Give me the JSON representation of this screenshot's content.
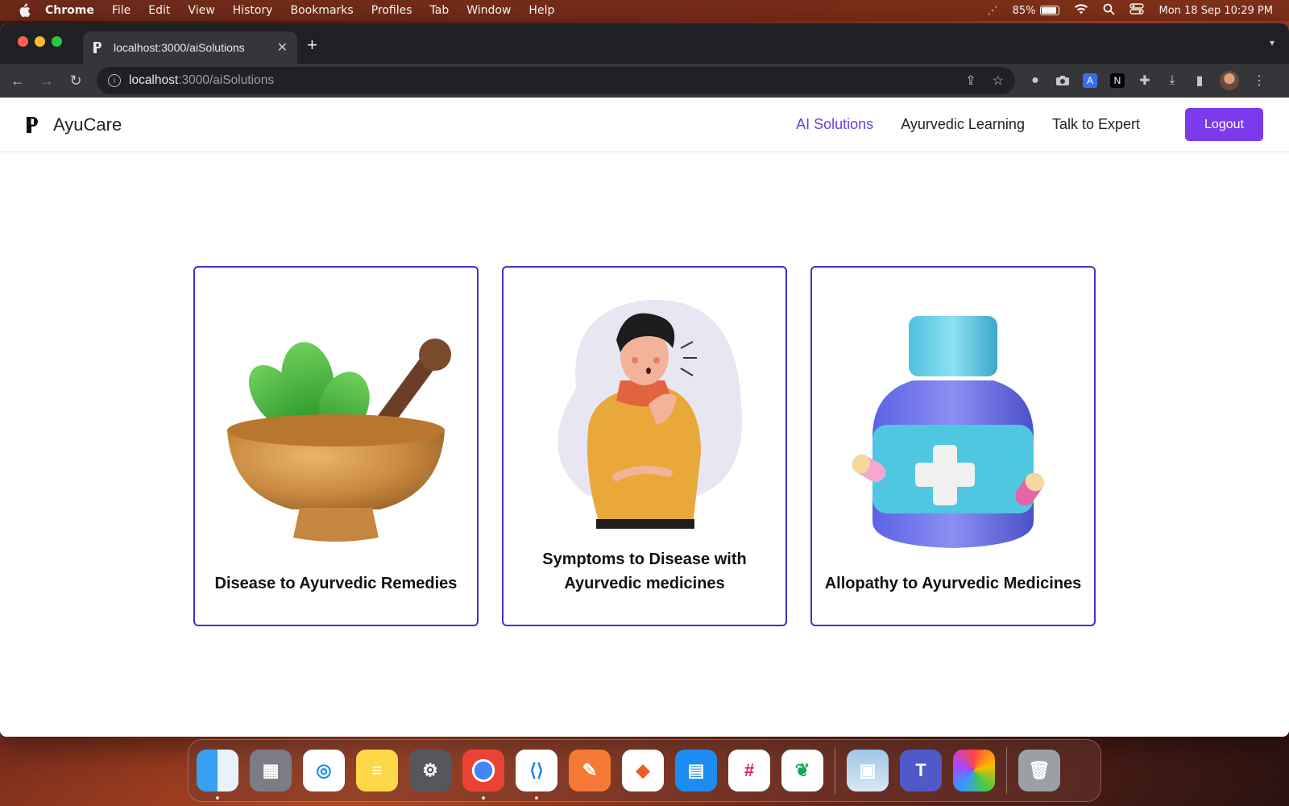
{
  "menubar": {
    "app": "Chrome",
    "items": [
      "File",
      "Edit",
      "View",
      "History",
      "Bookmarks",
      "Profiles",
      "Tab",
      "Window",
      "Help"
    ],
    "battery": "85%",
    "datetime": "Mon 18 Sep  10:29 PM"
  },
  "browser": {
    "tab_title": "localhost:3000/aiSolutions",
    "url_host": "localhost",
    "url_path": ":3000/aiSolutions"
  },
  "app": {
    "brand": "AyuCare",
    "nav": {
      "ai_solutions": "AI Solutions",
      "ayurvedic_learning": "Ayurvedic Learning",
      "talk_to_expert": "Talk to Expert",
      "logout": "Logout"
    },
    "cards": [
      {
        "caption": "Disease to Ayurvedic Remedies",
        "icon": "mortar-pestle-herbs-icon"
      },
      {
        "caption": "Symptoms to Disease with Ayurvedic medicines",
        "icon": "coughing-person-icon"
      },
      {
        "caption": "Allopathy to Ayurvedic Medicines",
        "icon": "medicine-bottle-icon"
      }
    ]
  },
  "colors": {
    "accent": "#7c3aed",
    "active_nav": "#6b3fd8",
    "card_border": "#3b35c9"
  }
}
